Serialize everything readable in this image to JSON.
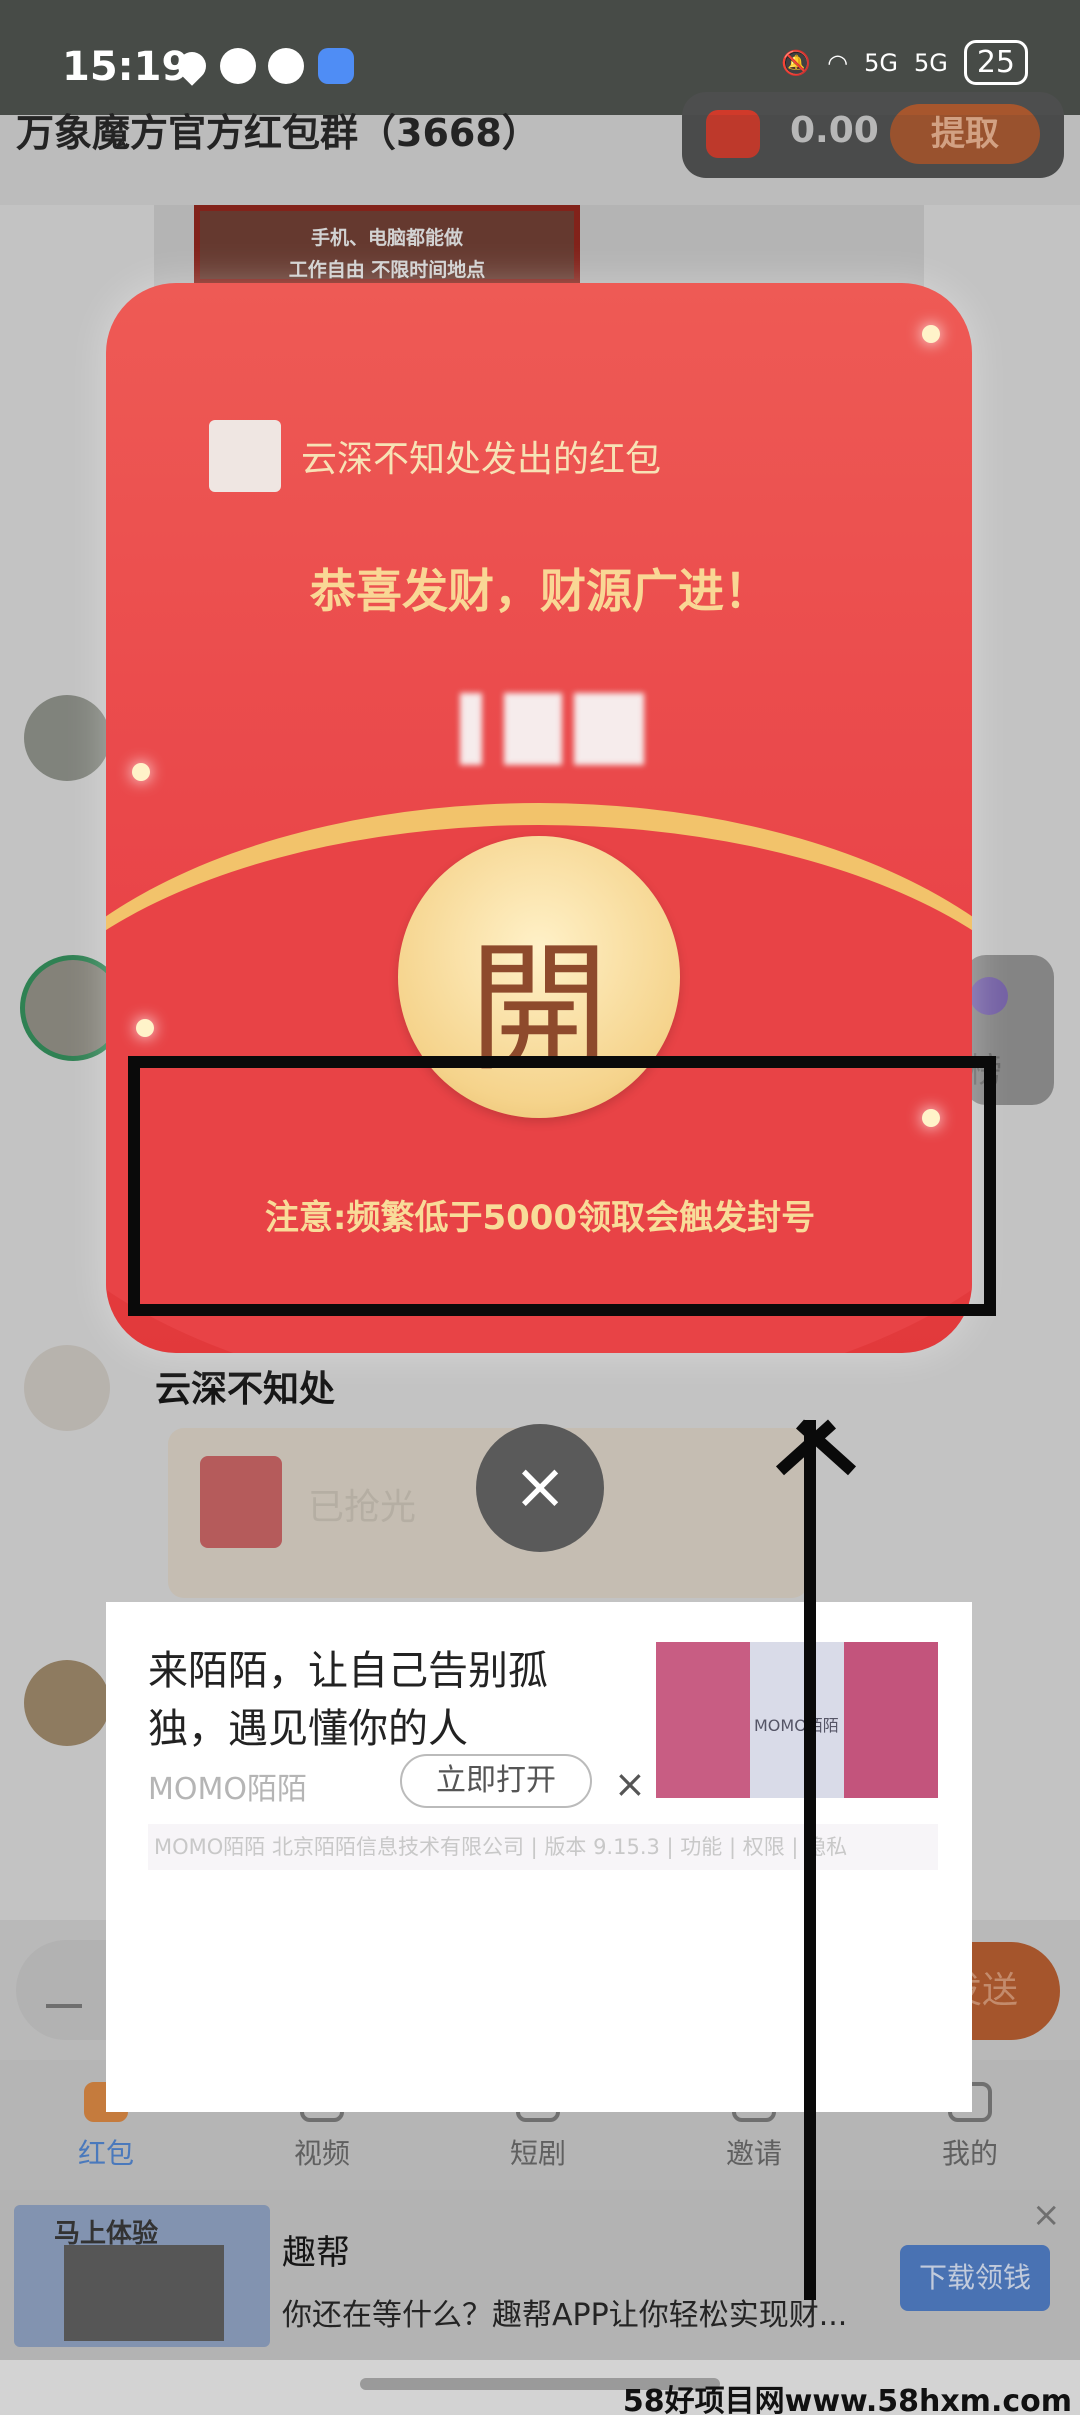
{
  "status_bar": {
    "time": "15:19",
    "signal_1": "5G",
    "signal_2": "5G",
    "battery": "25"
  },
  "chat": {
    "title": "万象魔方官方红包群（3668）",
    "wallet_amount": "0.00",
    "withdraw_label": "提取",
    "promo_line1": "手机、电脑都能做",
    "promo_line2": "工作自由 不限时间地点",
    "rank_label": "榜",
    "sender_name": "云深不知处",
    "taken_label": "已抢光",
    "send_label": "发送"
  },
  "red_packet": {
    "sender_line": "云深不知处发出的红包",
    "greeting": "恭喜发财，财源广进！",
    "open_char": "開",
    "notice": "注意:频繁低于5000领取会触发封号",
    "colors": {
      "body": "#e94448",
      "gold": "#f2c36b",
      "highlight_box": "#0a0a0a"
    }
  },
  "close_icon": "×",
  "momo_ad": {
    "title": "来陌陌，让自己告别孤独，遇见懂你的人",
    "brand": "MOMO陌陌",
    "open_label": "立即打开",
    "close": "×",
    "image_caption": "MOMO陌陌",
    "meta": "MOMO陌陌 北京陌陌信息技术有限公司 | 版本 9.15.3 | 功能 | 权限 | 隐私"
  },
  "tabbar": {
    "items": [
      {
        "label": "红包",
        "active": true
      },
      {
        "label": "视频",
        "active": false
      },
      {
        "label": "短剧",
        "active": false
      },
      {
        "label": "邀请",
        "active": false
      },
      {
        "label": "我的",
        "active": false
      }
    ]
  },
  "bottom_ad": {
    "thumb_text": "马上体验",
    "title": "趣帮",
    "desc": "你还在等什么？趣帮APP让你轻松实现财...",
    "download_label": "下载领钱",
    "close": "×"
  },
  "watermark": "58好项目网www.58hxm.com"
}
